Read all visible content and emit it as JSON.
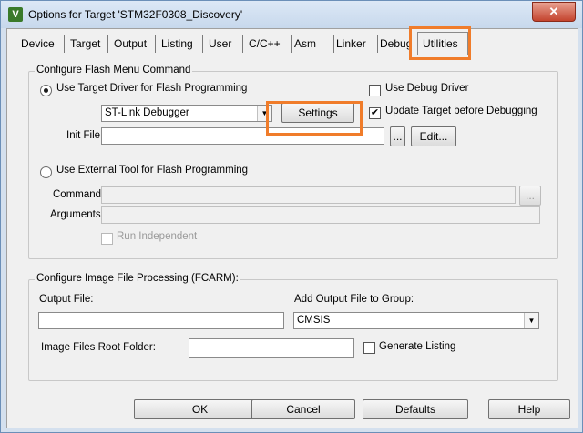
{
  "window": {
    "title": "Options for Target 'STM32F0308_Discovery'",
    "icon_letter": "V",
    "close_symbol": "✕"
  },
  "tabs": [
    {
      "label": "Device"
    },
    {
      "label": "Target"
    },
    {
      "label": "Output"
    },
    {
      "label": "Listing"
    },
    {
      "label": "User"
    },
    {
      "label": "C/C++"
    },
    {
      "label": "Asm"
    },
    {
      "label": "Linker"
    },
    {
      "label": "Debug"
    },
    {
      "label": "Utilities"
    }
  ],
  "flash_group": {
    "title": "Configure Flash Menu Command",
    "use_target_driver": {
      "label": "Use Target Driver for Flash Programming",
      "selected": true
    },
    "driver_value": "ST-Link Debugger",
    "settings_label": "Settings",
    "use_debug_driver": {
      "label": "Use Debug Driver",
      "checked": false
    },
    "update_target": {
      "label": "Update Target before Debugging",
      "checked": true
    },
    "init_file_label": "Init File:",
    "init_file_value": "",
    "browse_label": "...",
    "edit_label": "Edit...",
    "use_external_tool": {
      "label": "Use External Tool for Flash Programming",
      "selected": false
    },
    "command_label": "Command:",
    "command_value": "",
    "arguments_label": "Arguments:",
    "arguments_value": "",
    "run_independent": {
      "label": "Run Independent",
      "checked": false
    }
  },
  "image_group": {
    "title": "Configure Image File Processing (FCARM):",
    "output_file_label": "Output File:",
    "output_file_value": "",
    "add_output_label": "Add Output File  to Group:",
    "group_value": "CMSIS",
    "root_folder_label": "Image Files Root Folder:",
    "root_folder_value": "",
    "generate_listing": {
      "label": "Generate Listing",
      "checked": false
    }
  },
  "footer": {
    "ok": "OK",
    "cancel": "Cancel",
    "defaults": "Defaults",
    "help": "Help"
  },
  "check_mark": "✔",
  "dropdown_glyph": "▼",
  "highlight_color": "#f07c2a"
}
